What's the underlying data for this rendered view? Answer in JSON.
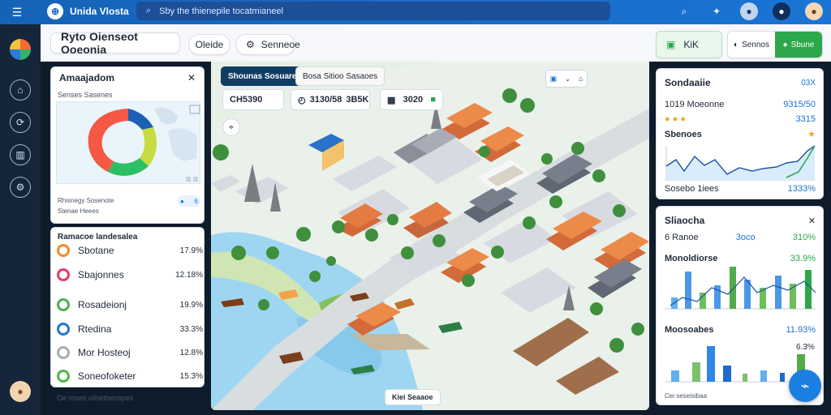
{
  "topbar": {
    "brand": "Unida Vlosta",
    "search_text": "Sby the thienepile tocatmianeel"
  },
  "header": {
    "title": "Ryto Oienseot Ooeonia",
    "chip1": "Oleide",
    "chip2": "Senneoe",
    "right_left": "KiK",
    "right_mid": "Sennos",
    "right_right": "Sbune"
  },
  "left_panel": {
    "title": "Amaajadom",
    "subtitle": "Senses Sasenes",
    "footer_line1": "Rhisnegy Sosenote",
    "footer_line2": "Stenae Heees",
    "mini_badge": "6"
  },
  "status_list": {
    "title": "Ramacoe landesalea",
    "items": [
      {
        "label": "Sbotane",
        "value": "17.9%",
        "color": "#f58a2a"
      },
      {
        "label": "Sbajonnes",
        "value": "12.18%",
        "color": "#e33d67"
      },
      {
        "label": "Rosadeionj",
        "value": "19.9%",
        "color": "#4caf50"
      },
      {
        "label": "Rtedina",
        "value": "33.3%",
        "color": "#1f78d1"
      },
      {
        "label": "Mor Hosteoj",
        "value": "12.8%",
        "color": "#a8adb5"
      },
      {
        "label": "Soneofoketer",
        "value": "15.3%",
        "color": "#53b548"
      }
    ],
    "footer": "Oe roseti ollsetbenapes"
  },
  "map": {
    "tag": "Shounas Sosuarees",
    "tag2": "Bosa Sitioo Sasaoes",
    "stat1": "CH5390",
    "stat2": "3130/58",
    "stat3": "3B5K",
    "stat4": "3020",
    "bottom_tag": "Kiei Seaaoe"
  },
  "right_top": {
    "title": "Sondaaiie",
    "badge": "03X",
    "line1": "1019 Moeonne",
    "line1_value": "9315/50",
    "line2_value": "3315",
    "line3": "Sbenoes",
    "footer": "Sosebo 1iees",
    "footer_value": "1333%"
  },
  "right_bottom": {
    "title": "Sliaocha",
    "line1": "6 Ranoe",
    "line1_mid": "3oco",
    "line1_right": "310%",
    "line2": "Monoldiorse",
    "line2_value": "33.9%",
    "line3": "Moosoabes",
    "line3_value": "11.93%",
    "line3_value2": "6.3%",
    "footer": "Cei seseisibaa"
  },
  "colors": {
    "accent": "#1a74d4",
    "green": "#2ca74a",
    "orange": "#f58a2a"
  }
}
